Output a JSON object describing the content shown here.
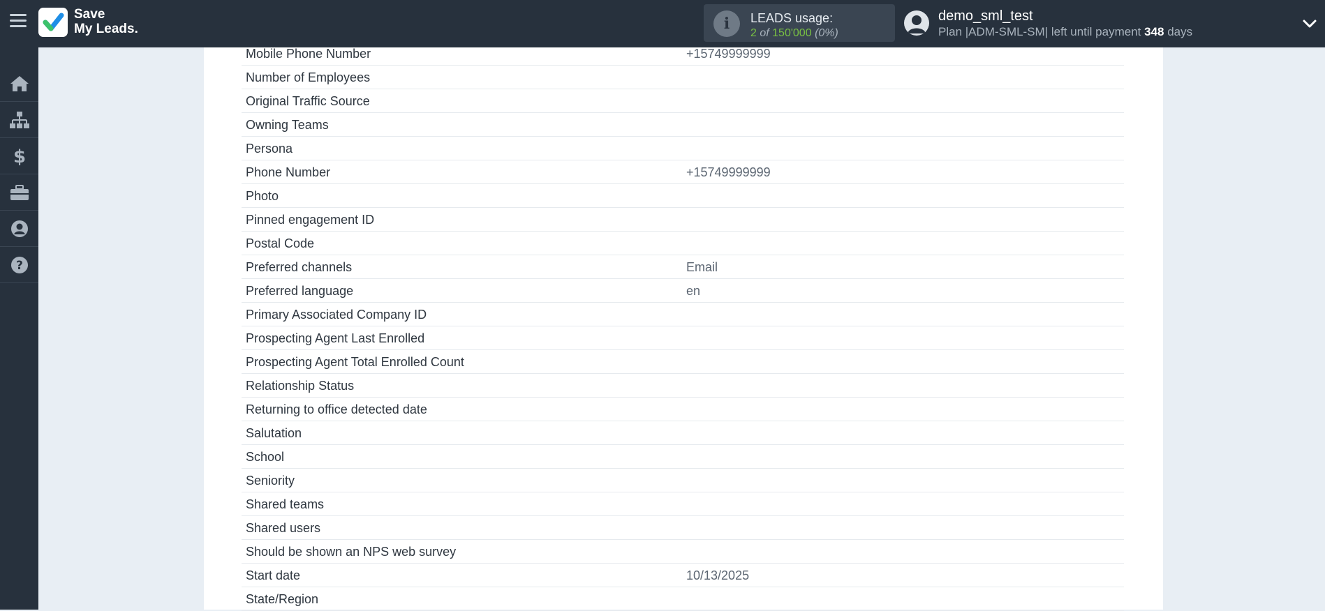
{
  "header": {
    "logo_line1": "Save",
    "logo_line2": "My Leads.",
    "usage": {
      "title": "LEADS usage:",
      "used": "2",
      "of_word": "of",
      "limit": "150'000",
      "percent": "(0%)"
    },
    "user": {
      "name": "demo_sml_test",
      "plan_prefix": "Plan |ADM-SML-SM| left until payment",
      "days": "348",
      "days_suffix": "days"
    }
  },
  "sidebar": {
    "items": [
      {
        "icon": "home-icon"
      },
      {
        "icon": "sitemap-icon"
      },
      {
        "icon": "dollar-icon"
      },
      {
        "icon": "briefcase-icon"
      },
      {
        "icon": "user-circle-icon"
      },
      {
        "icon": "question-circle-icon"
      }
    ]
  },
  "fields": [
    {
      "label": "Mobile Phone Number",
      "value": "+15749999999"
    },
    {
      "label": "Number of Employees",
      "value": ""
    },
    {
      "label": "Original Traffic Source",
      "value": ""
    },
    {
      "label": "Owning Teams",
      "value": ""
    },
    {
      "label": "Persona",
      "value": ""
    },
    {
      "label": "Phone Number",
      "value": "+15749999999"
    },
    {
      "label": "Photo",
      "value": ""
    },
    {
      "label": "Pinned engagement ID",
      "value": ""
    },
    {
      "label": "Postal Code",
      "value": ""
    },
    {
      "label": "Preferred channels",
      "value": "Email"
    },
    {
      "label": "Preferred language",
      "value": "en"
    },
    {
      "label": "Primary Associated Company ID",
      "value": ""
    },
    {
      "label": "Prospecting Agent Last Enrolled",
      "value": ""
    },
    {
      "label": "Prospecting Agent Total Enrolled Count",
      "value": ""
    },
    {
      "label": "Relationship Status",
      "value": ""
    },
    {
      "label": "Returning to office detected date",
      "value": ""
    },
    {
      "label": "Salutation",
      "value": ""
    },
    {
      "label": "School",
      "value": ""
    },
    {
      "label": "Seniority",
      "value": ""
    },
    {
      "label": "Shared teams",
      "value": ""
    },
    {
      "label": "Shared users",
      "value": ""
    },
    {
      "label": "Should be shown an NPS web survey",
      "value": ""
    },
    {
      "label": "Start date",
      "value": "10/13/2025"
    },
    {
      "label": "State/Region",
      "value": ""
    }
  ]
}
